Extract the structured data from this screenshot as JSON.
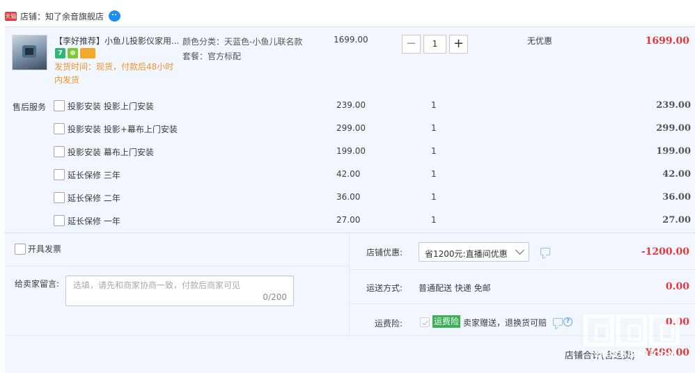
{
  "shop": {
    "badge": "天猫",
    "label": "店铺：知了余音旗舰店"
  },
  "product": {
    "title": "【李好推荐】小鱼儿投影仪家用...",
    "tags": [
      "7",
      "⊕",
      ""
    ],
    "ship_time": "发货时间：现货，付款后48小时内发货",
    "sku": [
      "颜色分类：天蓝色-小鱼儿联名款",
      "套餐：官方标配"
    ],
    "unit_price": "1699.00",
    "qty_minus": "−",
    "qty": "1",
    "qty_plus": "+",
    "discount": "无优惠",
    "total": "1699.00"
  },
  "services": {
    "label": "售后服务",
    "items": [
      {
        "name": "投影安装 投影上门安装",
        "price": "239.00",
        "qty": "1",
        "total": "239.00"
      },
      {
        "name": "投影安装 投影+幕布上门安装",
        "price": "299.00",
        "qty": "1",
        "total": "299.00"
      },
      {
        "name": "投影安装 幕布上门安装",
        "price": "199.00",
        "qty": "1",
        "total": "199.00"
      },
      {
        "name": "延长保修 三年",
        "price": "42.00",
        "qty": "1",
        "total": "42.00"
      },
      {
        "name": "延长保修 二年",
        "price": "36.00",
        "qty": "1",
        "total": "36.00"
      },
      {
        "name": "延长保修 一年",
        "price": "27.00",
        "qty": "1",
        "total": "27.00"
      }
    ]
  },
  "invoice": {
    "label": "开具发票"
  },
  "message": {
    "label": "给卖家留言:",
    "placeholder": "选填，请先和商家协商一致，付款后商家可见",
    "count": "0/200"
  },
  "coupon": {
    "label": "店铺优惠:",
    "selected": "省1200元:直播间优惠",
    "amount": "-1200.00"
  },
  "shipping": {
    "label": "运送方式:",
    "method": "普通配送 快递 免邮",
    "amount": "0.00"
  },
  "insurance": {
    "label": "运费险:",
    "badge": "运费险",
    "text": "卖家赠送，退换货可赔",
    "help": "?",
    "amount": "0.00"
  },
  "summary": {
    "label": "店铺合计(含运费)",
    "amount": "¥499.00"
  },
  "watermark": {
    "text": "ZHIZHIZHI.COM"
  }
}
